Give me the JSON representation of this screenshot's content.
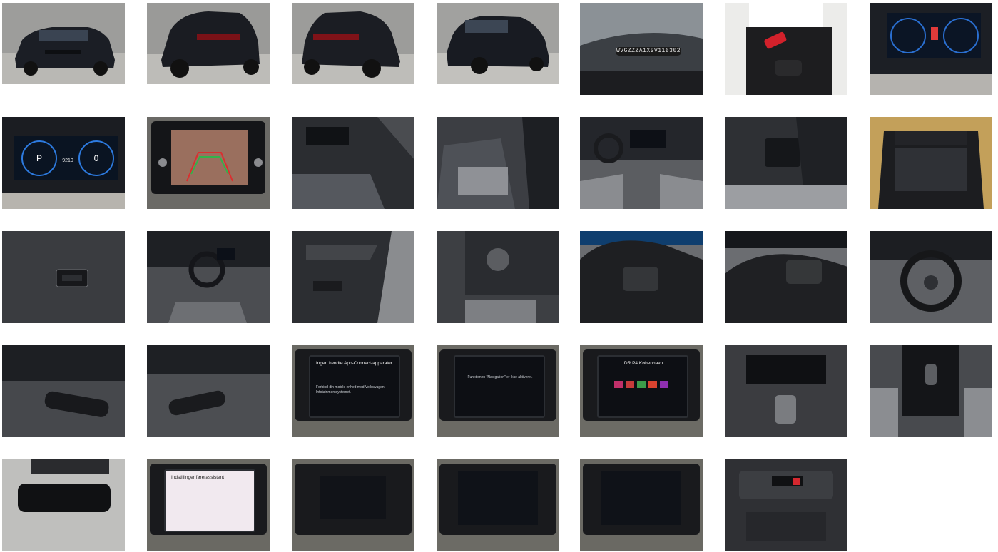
{
  "gallery": {
    "items": [
      {
        "alt": "front-three-quarter",
        "kind": "ext-front"
      },
      {
        "alt": "rear-three-quarter-left",
        "kind": "ext-rear"
      },
      {
        "alt": "rear-three-quarter-right",
        "kind": "ext-rear"
      },
      {
        "alt": "front-three-quarter-right",
        "kind": "ext-front"
      },
      {
        "alt": "vin-plate",
        "kind": "vin",
        "text": "WVGZZZA1XSV116302"
      },
      {
        "alt": "keys-and-folder",
        "kind": "keys"
      },
      {
        "alt": "instrument-cluster",
        "kind": "cluster"
      },
      {
        "alt": "digital-cockpit",
        "kind": "cluster",
        "text": "9210"
      },
      {
        "alt": "reversing-camera",
        "kind": "camera"
      },
      {
        "alt": "driver-door-view",
        "kind": "interior"
      },
      {
        "alt": "rear-seats",
        "kind": "seats"
      },
      {
        "alt": "dashboard-overview",
        "kind": "dash"
      },
      {
        "alt": "rear-vents",
        "kind": "seats"
      },
      {
        "alt": "boot-open",
        "kind": "boot"
      },
      {
        "alt": "boot-switch",
        "kind": "switch"
      },
      {
        "alt": "cockpit-left",
        "kind": "dash"
      },
      {
        "alt": "door-panel",
        "kind": "door"
      },
      {
        "alt": "light-switch-pedals",
        "kind": "switch"
      },
      {
        "alt": "steering-wheel-right-buttons",
        "kind": "wheel"
      },
      {
        "alt": "steering-wheel-left-buttons",
        "kind": "wheel"
      },
      {
        "alt": "steering-wheel",
        "kind": "wheel"
      },
      {
        "alt": "wiper-stalk",
        "kind": "stalk"
      },
      {
        "alt": "indicator-stalk",
        "kind": "stalk"
      },
      {
        "alt": "infotainment-app-connect",
        "kind": "screen",
        "title": "Ingen kendte App-Connect-apparater",
        "text": "Forbind din mobile enhed med Volkswagen-Infotainmentsystemet."
      },
      {
        "alt": "infotainment-navigation-prompt",
        "kind": "screen",
        "title": "",
        "text": "Funktionen \"Navigation\" er ikke aktiveret."
      },
      {
        "alt": "infotainment-radio",
        "kind": "screen",
        "title": "DR P4 København",
        "text": ""
      },
      {
        "alt": "center-console-climate",
        "kind": "console"
      },
      {
        "alt": "gear-selector",
        "kind": "console"
      },
      {
        "alt": "rear-view-mirror",
        "kind": "mirror"
      },
      {
        "alt": "infotainment-driver-assist-settings",
        "kind": "screen",
        "title": "Indstillinger førerassistent",
        "text": ""
      },
      {
        "alt": "infotainment-home-menu",
        "kind": "screen",
        "title": "",
        "text": ""
      },
      {
        "alt": "infotainment-phone-pairing",
        "kind": "screen",
        "title": "",
        "text": ""
      },
      {
        "alt": "infotainment-media",
        "kind": "screen",
        "title": "",
        "text": ""
      },
      {
        "alt": "overhead-console",
        "kind": "overhead"
      }
    ]
  }
}
